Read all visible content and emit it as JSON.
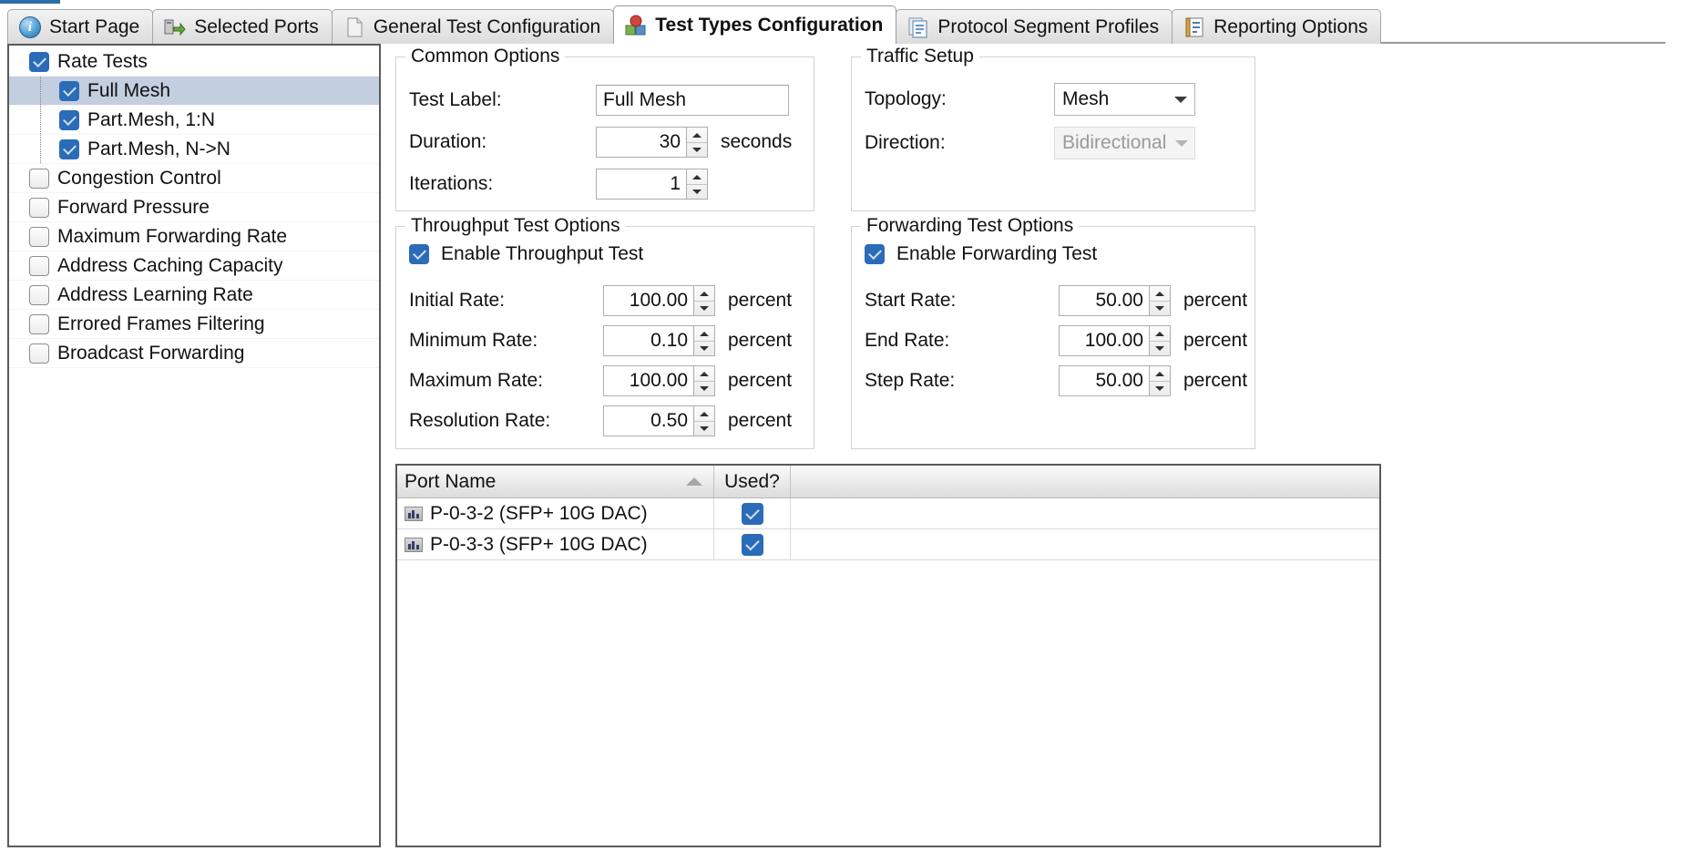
{
  "window": {
    "accent_color": "#2a6ea8"
  },
  "tabs": [
    {
      "label": "Start Page",
      "icon": "info-icon",
      "active": false
    },
    {
      "label": "Selected Ports",
      "icon": "selected-ports-icon",
      "active": false
    },
    {
      "label": "General Test Configuration",
      "icon": "document-icon",
      "active": false
    },
    {
      "label": "Test Types Configuration",
      "icon": "test-types-icon",
      "active": true
    },
    {
      "label": "Protocol Segment Profiles",
      "icon": "profiles-icon",
      "active": false
    },
    {
      "label": "Reporting Options",
      "icon": "report-icon",
      "active": false
    }
  ],
  "tree": {
    "items": [
      {
        "label": "Rate Tests",
        "level": 0,
        "checked": true,
        "selected": false
      },
      {
        "label": "Full Mesh",
        "level": 1,
        "checked": true,
        "selected": true
      },
      {
        "label": "Part.Mesh, 1:N",
        "level": 1,
        "checked": true,
        "selected": false
      },
      {
        "label": "Part.Mesh, N->N",
        "level": 1,
        "checked": true,
        "selected": false
      },
      {
        "label": "Congestion Control",
        "level": 0,
        "checked": false,
        "selected": false
      },
      {
        "label": "Forward Pressure",
        "level": 0,
        "checked": false,
        "selected": false
      },
      {
        "label": "Maximum Forwarding Rate",
        "level": 0,
        "checked": false,
        "selected": false
      },
      {
        "label": "Address Caching Capacity",
        "level": 0,
        "checked": false,
        "selected": false
      },
      {
        "label": "Address Learning Rate",
        "level": 0,
        "checked": false,
        "selected": false
      },
      {
        "label": "Errored Frames Filtering",
        "level": 0,
        "checked": false,
        "selected": false
      },
      {
        "label": "Broadcast Forwarding",
        "level": 0,
        "checked": false,
        "selected": false
      }
    ]
  },
  "common_options": {
    "legend": "Common Options",
    "test_label": {
      "label": "Test Label:",
      "value": "Full Mesh"
    },
    "duration": {
      "label": "Duration:",
      "value": "30",
      "unit": "seconds"
    },
    "iterations": {
      "label": "Iterations:",
      "value": "1",
      "unit": ""
    }
  },
  "traffic_setup": {
    "legend": "Traffic Setup",
    "topology": {
      "label": "Topology:",
      "value": "Mesh",
      "enabled": true
    },
    "direction": {
      "label": "Direction:",
      "value": "Bidirectional",
      "enabled": false
    }
  },
  "throughput_test": {
    "legend": "Throughput Test Options",
    "enable": {
      "label": "Enable Throughput Test",
      "checked": true
    },
    "rows": [
      {
        "label": "Initial Rate:",
        "value": "100.00",
        "unit": "percent"
      },
      {
        "label": "Minimum Rate:",
        "value": "0.10",
        "unit": "percent"
      },
      {
        "label": "Maximum Rate:",
        "value": "100.00",
        "unit": "percent"
      },
      {
        "label": "Resolution Rate:",
        "value": "0.50",
        "unit": "percent"
      }
    ]
  },
  "forwarding_test": {
    "legend": "Forwarding Test Options",
    "enable": {
      "label": "Enable Forwarding Test",
      "checked": true
    },
    "rows": [
      {
        "label": "Start Rate:",
        "value": "50.00",
        "unit": "percent"
      },
      {
        "label": "End Rate:",
        "value": "100.00",
        "unit": "percent"
      },
      {
        "label": "Step Rate:",
        "value": "50.00",
        "unit": "percent"
      }
    ]
  },
  "ports_grid": {
    "columns": [
      {
        "key": "name",
        "label": "Port Name",
        "sorted": "asc"
      },
      {
        "key": "used",
        "label": "Used?",
        "sorted": ""
      }
    ],
    "rows": [
      {
        "name": "P-0-3-2 (SFP+ 10G DAC)",
        "used": true,
        "icon": "port-icon"
      },
      {
        "name": "P-0-3-3 (SFP+ 10G DAC)",
        "used": true,
        "icon": "port-icon"
      }
    ]
  }
}
